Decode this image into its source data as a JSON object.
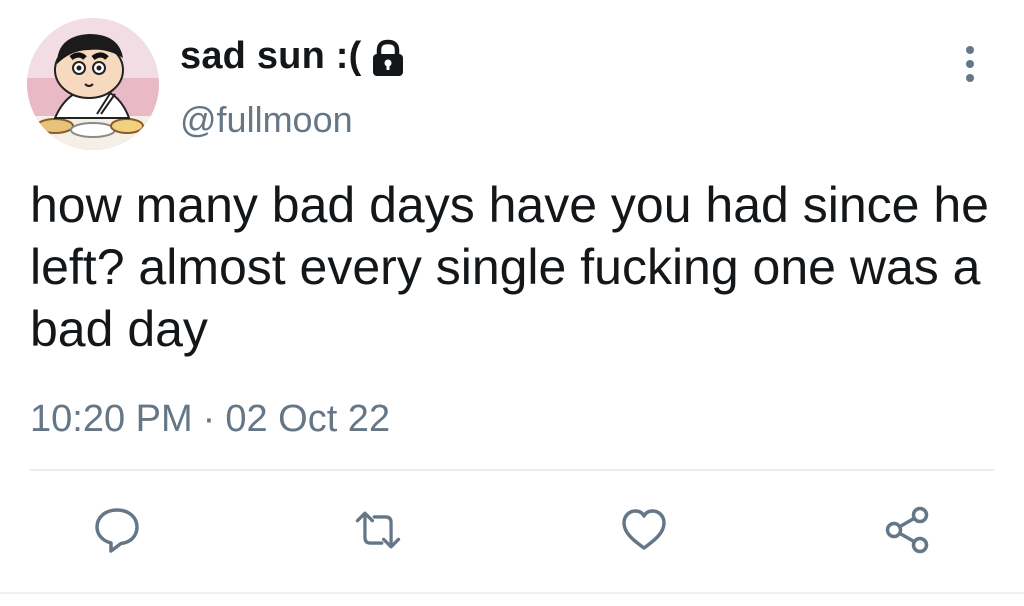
{
  "user": {
    "display_name": "sad sun :(",
    "handle": "@fullmoon",
    "protected_icon": "lock-icon",
    "avatar_icon": "cartoon-avatar"
  },
  "tweet": {
    "text": "how many bad days have you had since he left? almost every single fucking one was a bad day",
    "time": "10:20 PM",
    "separator": "·",
    "date": "02 Oct 22"
  },
  "actions": [
    {
      "name": "reply",
      "icon": "reply-icon"
    },
    {
      "name": "retweet",
      "icon": "retweet-icon"
    },
    {
      "name": "like",
      "icon": "heart-icon"
    },
    {
      "name": "share",
      "icon": "share-icon"
    }
  ],
  "menu_icon": "more-vertical-icon",
  "colors": {
    "text": "#14171a",
    "secondary": "#657786",
    "divider": "#e6ecf0",
    "icon": "#657786"
  }
}
